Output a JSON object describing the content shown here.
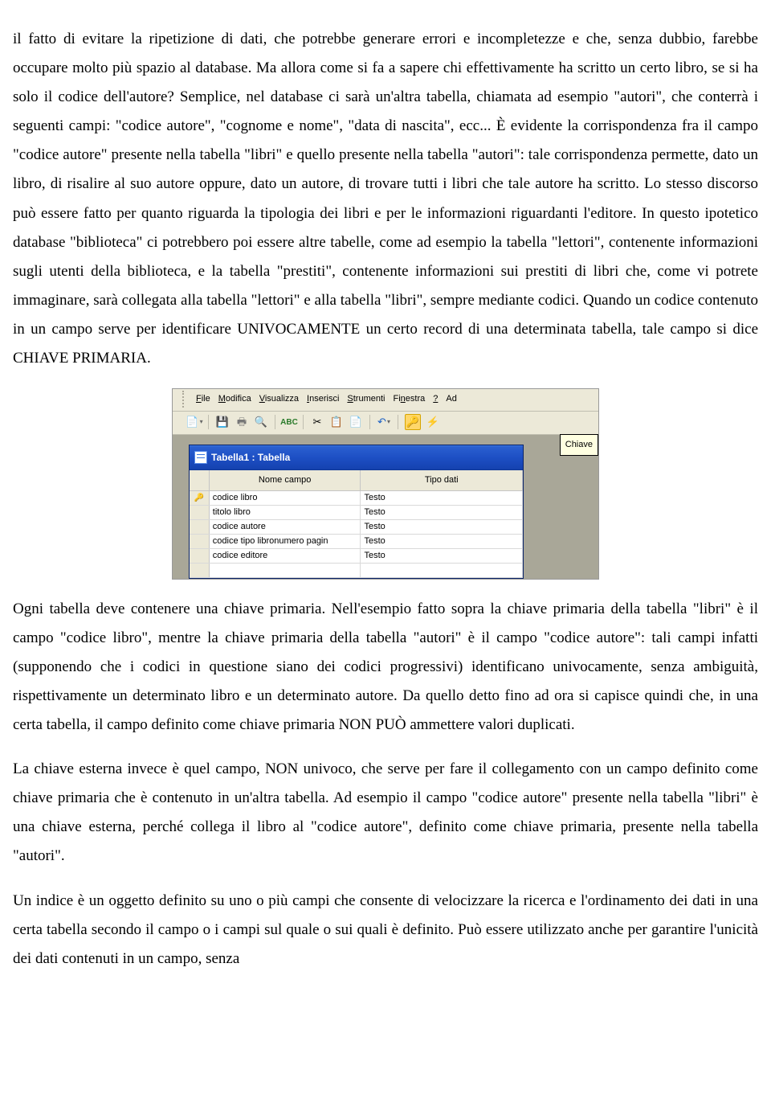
{
  "paragraphs": {
    "p1": "il fatto di evitare la ripetizione di dati, che potrebbe generare errori e incompletezze e che, senza dubbio, farebbe occupare molto più spazio al database. Ma allora come si fa a sapere chi effettivamente ha scritto un certo libro, se si ha solo il codice dell'autore? Semplice, nel database ci sarà un'altra tabella, chiamata ad esempio \"autori\", che conterrà i seguenti campi: \"codice autore\", \"cognome e nome\", \"data di nascita\", ecc... È evidente la corrispondenza fra il campo \"codice autore\" presente nella tabella \"libri\" e quello presente nella tabella \"autori\": tale corrispondenza permette, dato un libro, di risalire al suo autore oppure, dato un autore, di trovare tutti i libri che tale autore ha scritto. Lo stesso discorso può essere fatto per quanto riguarda la tipologia dei libri e per le informazioni riguardanti l'editore. In questo ipotetico database \"biblioteca\" ci potrebbero poi essere altre tabelle, come ad esempio la tabella \"lettori\", contenente informazioni sugli utenti della biblioteca, e la tabella \"prestiti\", contenente informazioni sui prestiti di libri che, come vi potrete immaginare, sarà collegata alla tabella \"lettori\" e alla tabella \"libri\", sempre mediante codici. Quando un codice contenuto in un campo serve per identificare UNIVOCAMENTE un certo record di una determinata tabella, tale campo si dice CHIAVE PRIMARIA.",
    "p2": "Ogni tabella deve contenere una chiave primaria. Nell'esempio fatto sopra la chiave primaria della tabella \"libri\" è il campo \"codice libro\", mentre la chiave primaria della tabella \"autori\" è il campo \"codice autore\": tali campi infatti (supponendo che i codici in questione siano dei codici progressivi) identificano univocamente, senza ambiguità, rispettivamente un determinato libro e un determinato autore. Da quello detto fino ad ora si capisce quindi che, in una certa tabella, il campo definito come chiave primaria NON PUÒ ammettere valori duplicati.",
    "p3": "La chiave esterna invece è quel campo, NON univoco, che serve per fare il collegamento con un campo definito come chiave primaria che è contenuto in un'altra tabella. Ad esempio il campo \"codice autore\" presente nella tabella \"libri\" è una chiave esterna, perché collega il libro al \"codice autore\", definito come chiave primaria, presente nella tabella \"autori\".",
    "p4": "Un indice è un oggetto definito su uno o più campi che consente di velocizzare la ricerca e l'ordinamento dei dati in una certa tabella secondo il campo o i campi sul quale o sui quali è definito. Può essere utilizzato anche per garantire l'unicità dei dati contenuti in un campo, senza"
  },
  "screenshot": {
    "menubar": {
      "items": [
        {
          "label": "File",
          "accel": "F"
        },
        {
          "label": "Modifica",
          "accel": "M"
        },
        {
          "label": "Visualizza",
          "accel": "V"
        },
        {
          "label": "Inserisci",
          "accel": "I"
        },
        {
          "label": "Strumenti",
          "accel": "S"
        },
        {
          "label": "Finestra",
          "accel": "n"
        },
        {
          "label": "?",
          "accel": "?"
        },
        {
          "label": "Ad",
          "accel": ""
        }
      ]
    },
    "tooltip": "Chiave",
    "window": {
      "title": "Tabella1 : Tabella",
      "headers": {
        "name": "Nome campo",
        "type": "Tipo dati"
      },
      "rows": [
        {
          "key": true,
          "name": "codice libro",
          "type": "Testo"
        },
        {
          "key": false,
          "name": "titolo libro",
          "type": "Testo"
        },
        {
          "key": false,
          "name": "codice autore",
          "type": "Testo"
        },
        {
          "key": false,
          "name": "codice tipo libronumero pagin",
          "type": "Testo"
        },
        {
          "key": false,
          "name": "codice editore",
          "type": "Testo"
        },
        {
          "key": false,
          "name": "",
          "type": ""
        }
      ]
    }
  }
}
